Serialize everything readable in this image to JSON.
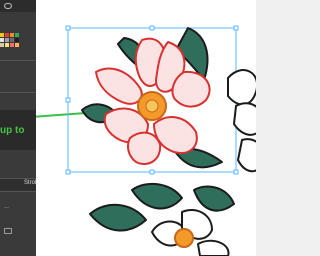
{
  "window": {
    "title": ""
  },
  "panels": {
    "swatches": {
      "colors": [
        "#f5c518",
        "#e63b2e",
        "#f28b2b",
        "#2eaa5c",
        "#3f7fd3",
        "#e2e2e2",
        "#a1a1a1",
        "#6b6b6b",
        "#1e1e1e",
        "#d9c7a5",
        "#f6e27a",
        "#ff6a6a",
        "#ffb05a",
        "#6bd19a",
        "#6fa7f2",
        "#f7f7f7"
      ]
    },
    "tip": {
      "text": "up to"
    },
    "stroke": {
      "label": "Stroke"
    }
  },
  "canvas": {
    "accent_selection_color": "#59b8ff",
    "flower_fill": "#fbe3e3",
    "flower_stroke": "#d9312f",
    "leaf_fill": "#2f6e5a",
    "leaf_stroke": "#1b1b1b",
    "center_fill": "#f39a2a",
    "guide_line_color": "#3bbf4a"
  },
  "icons": {
    "eye": "eye-icon",
    "corner": "artboard-corner-icon"
  }
}
